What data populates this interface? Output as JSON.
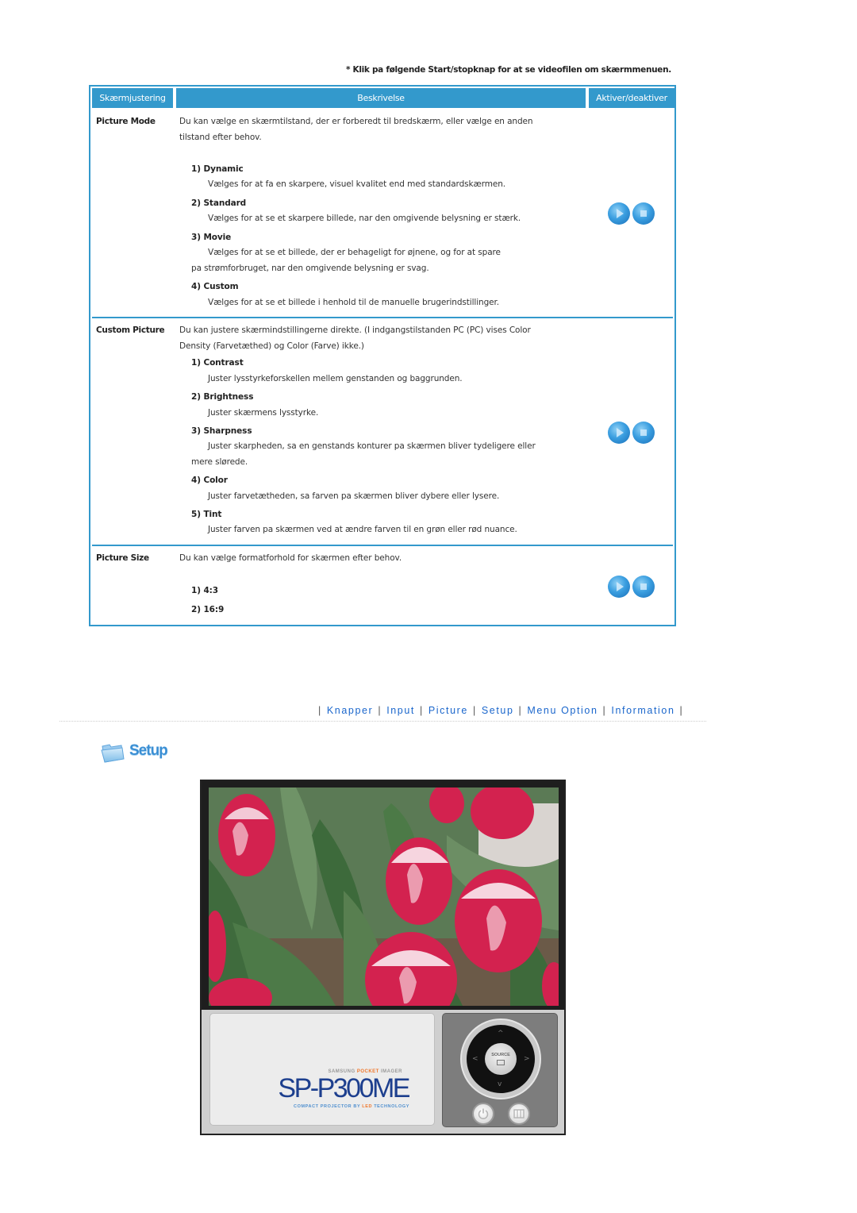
{
  "note": "* Klik pa følgende Start/stopknap for at se videofilen om skærmmenuen.",
  "table": {
    "headers": [
      "Skærmjustering",
      "Beskrivelse",
      "Aktiver/deaktiver"
    ],
    "header_color": "#3399cc",
    "rows": [
      {
        "label": "Picture Mode",
        "intro": [
          "Du kan vælge en skærmtilstand, der er forberedt til bredskærm, eller vælge en anden",
          "tilstand efter behov."
        ],
        "items": [
          {
            "title": "1) Dynamic",
            "text": [
              "Vælges for at fa en skarpere, visuel kvalitet end med standardskærmen."
            ]
          },
          {
            "title": "2) Standard",
            "text": [
              "Vælges for at se et skarpere billede, nar den omgivende belysning er stærk."
            ]
          },
          {
            "title": "3) Movie",
            "text": [
              "Vælges for at se et billede, der er behageligt for øjnene, og for at spare",
              "pa strømforbruget, nar den omgivende belysning er svag."
            ]
          },
          {
            "title": "4) Custom",
            "text": [
              "Vælges for at se et billede i henhold til de manuelle brugerindstillinger."
            ]
          }
        ],
        "actions": {
          "play": "play-icon",
          "stop": "stop-icon"
        }
      },
      {
        "label": "Custom Picture",
        "intro": [
          "Du kan justere skærmindstillingerne direkte. (I indgangstilstanden PC (PC) vises Color",
          "Density (Farvetæthed) og Color (Farve) ikke.)"
        ],
        "items": [
          {
            "title": "1) Contrast",
            "text": [
              "Juster lysstyrkeforskellen mellem genstanden og baggrunden."
            ]
          },
          {
            "title": "2) Brightness",
            "text": [
              "Juster skærmens lysstyrke."
            ]
          },
          {
            "title": "3) Sharpness",
            "text": [
              "Juster skarpheden, sa en genstands konturer pa skærmen bliver tydeligere eller",
              "mere slørede."
            ]
          },
          {
            "title": "4) Color",
            "text": [
              "Juster farvetætheden, sa farven pa skærmen bliver dybere eller lysere."
            ]
          },
          {
            "title": "5) Tint",
            "text": [
              "Juster farven pa skærmen ved at ændre farven til en grøn eller rød nuance."
            ]
          }
        ],
        "actions": {
          "play": "play-icon",
          "stop": "stop-icon"
        }
      },
      {
        "label": "Picture Size",
        "intro": [
          "Du kan vælge formatforhold for skærmen efter behov."
        ],
        "items": [
          {
            "title": "1) 4:3",
            "text": []
          },
          {
            "title": "2) 16:9",
            "text": []
          }
        ],
        "actions": {
          "play": "play-icon",
          "stop": "stop-icon"
        }
      }
    ]
  },
  "nav": {
    "links": [
      "Knapper",
      "Input",
      "Picture",
      "Setup",
      "Menu Option",
      "Information"
    ],
    "separator": "|",
    "link_color": "#1a66cc"
  },
  "section": {
    "title": "Setup",
    "icon": "folder-icon"
  },
  "device": {
    "photo_subject": "red-white tulips",
    "brand_prefix": "SAMSUNG ",
    "brand_accent": "POCKET",
    "brand_suffix": " IMAGER",
    "model": "SP-P300ME",
    "tagline_prefix": "COMPACT PROJECTOR BY ",
    "tagline_accent": "LED",
    "tagline_suffix": " TECHNOLOGY",
    "source_label": "SOURCE",
    "arrows": {
      "up": "^",
      "down": "v",
      "left": "<",
      "right": ">"
    }
  }
}
